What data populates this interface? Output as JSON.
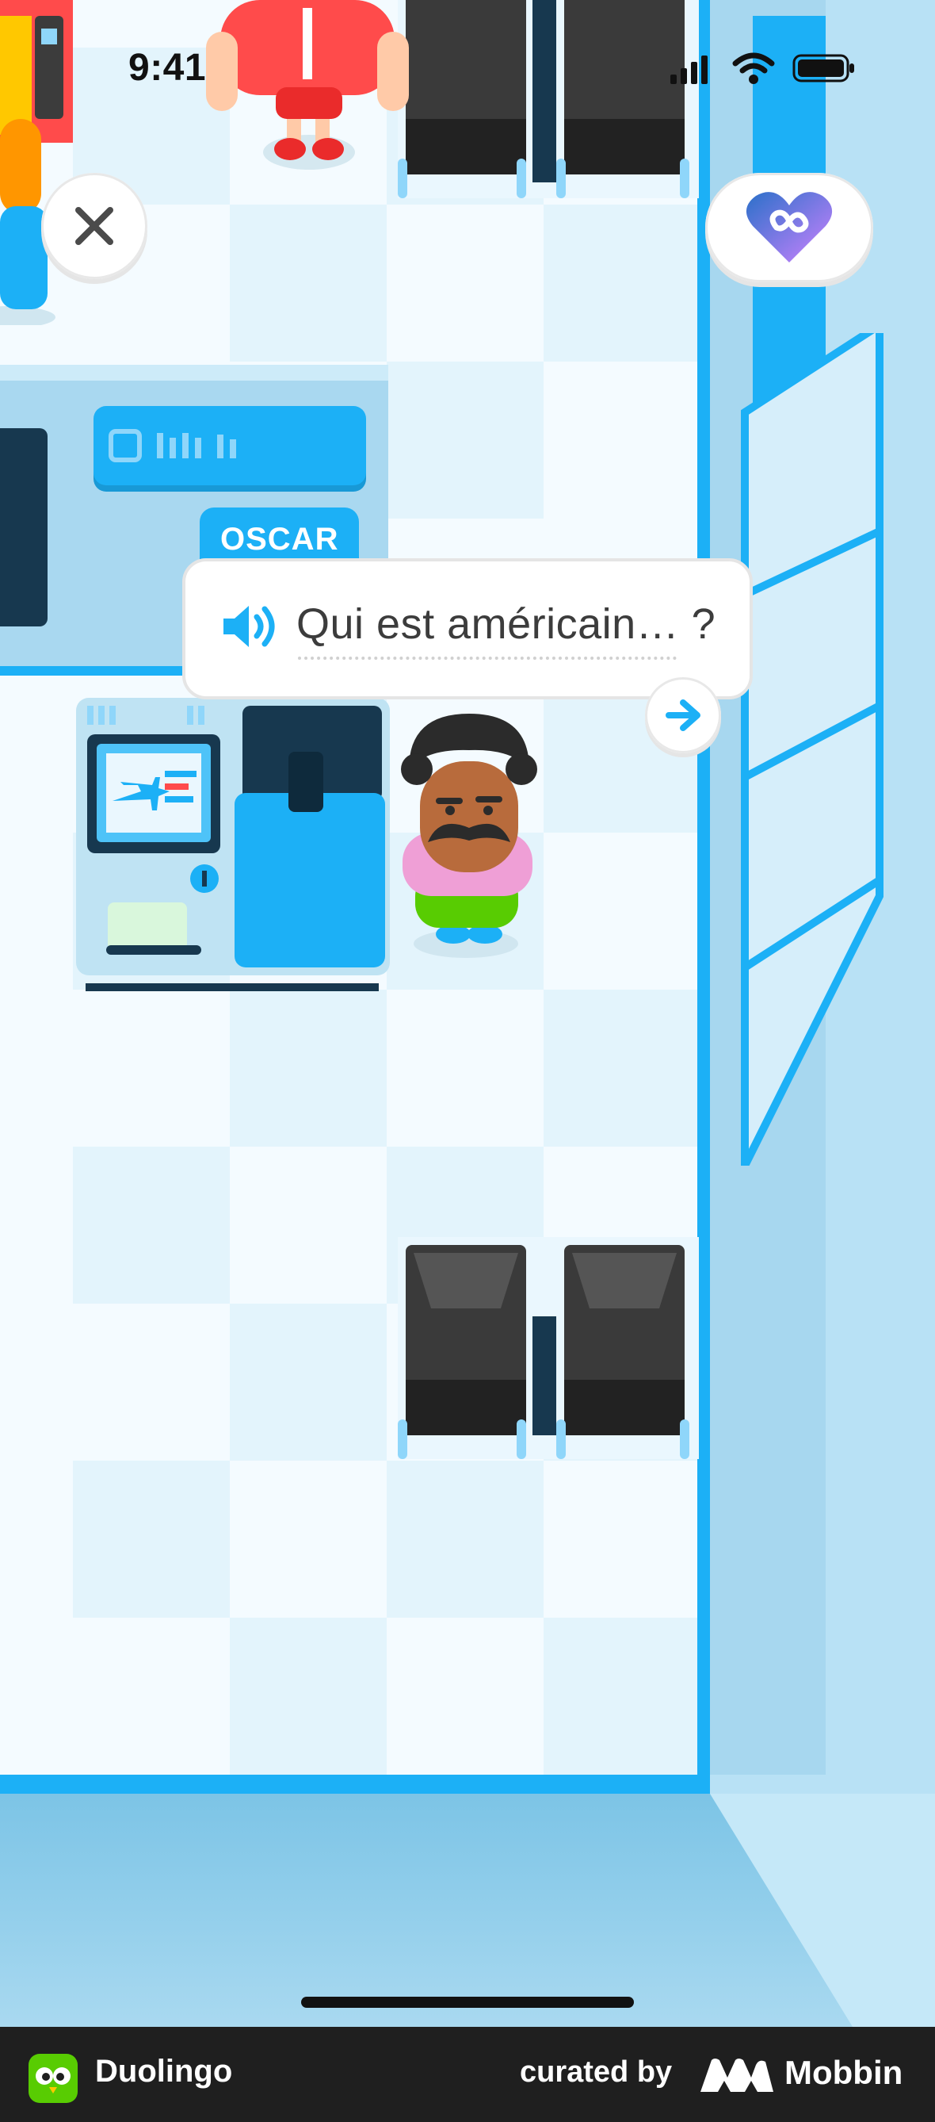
{
  "status_bar": {
    "time": "9:41"
  },
  "dialogue": {
    "speaker_name": "OSCAR",
    "text": "Qui est américain… ?"
  },
  "icons": {
    "close": "close-icon",
    "hearts": "infinite-hearts-icon",
    "audio": "speaker-icon",
    "next": "arrow-right-icon"
  },
  "colors": {
    "accent": "#1cb0f6",
    "heart_gradient_start": "#2b70c9",
    "heart_gradient_end": "#ce82ff"
  },
  "footer": {
    "app_name": "Duolingo",
    "curated_by": "curated by",
    "brand": "Mobbin"
  }
}
